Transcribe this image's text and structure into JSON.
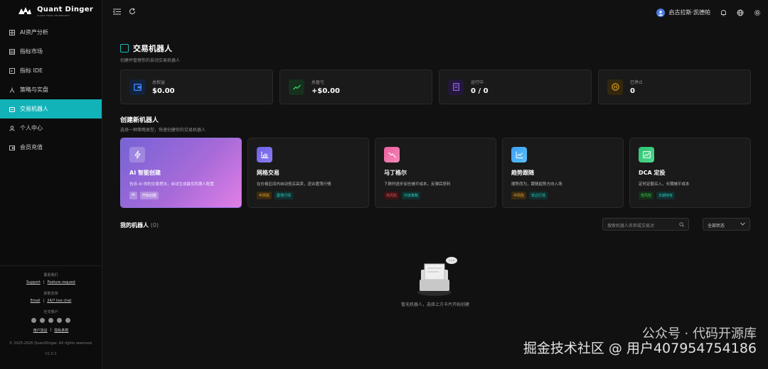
{
  "brand": {
    "title": "Quant Dinger",
    "subtitle": "QUANT FROM UNCERTAINTY"
  },
  "sidebar": {
    "items": [
      {
        "label": "AI资产分析",
        "icon": "chart-grid-icon"
      },
      {
        "label": "指标市场",
        "icon": "store-icon"
      },
      {
        "label": "指标 IDE",
        "icon": "code-icon"
      },
      {
        "label": "策略与实盘",
        "icon": "strategy-icon"
      },
      {
        "label": "交易机器人",
        "icon": "robot-icon",
        "active": true
      },
      {
        "label": "个人中心",
        "icon": "user-icon"
      },
      {
        "label": "会员充值",
        "icon": "wallet-icon"
      }
    ],
    "footer": {
      "contact_head": "联系我们",
      "support": "Support",
      "feature": "Feature request",
      "help_head": "获取支持",
      "email": "Email",
      "live_chat": "24/7 live chat",
      "social_head": "社交账户",
      "terms": "用户协议",
      "privacy": "隐私条款",
      "copyright": "© 2025-2026 QuantDinger. All rights reserved.",
      "version": "V2.0.3"
    }
  },
  "topbar": {
    "user_name": "启古拉斯·凯德帕"
  },
  "page": {
    "title": "交易机器人",
    "subtitle": "创建并管理你的自动交易机器人"
  },
  "stats": [
    {
      "label": "总权益",
      "value": "$0.00",
      "icon": "wallet-icon",
      "color": "#1e6fd9"
    },
    {
      "label": "总盈亏",
      "value": "+$0.00",
      "icon": "trend-up-icon",
      "color": "#2bb24c"
    },
    {
      "label": "运行中",
      "value": "0 / 0",
      "icon": "document-icon",
      "color": "#7a4ad6"
    },
    {
      "label": "已停止",
      "value": "0",
      "icon": "pause-icon",
      "color": "#e0a11d"
    }
  ],
  "create": {
    "title": "创建新机器人",
    "subtitle": "选择一种策略类型，快速创建你的交易机器人"
  },
  "cards": [
    {
      "title": "AI 智能创建",
      "desc": "告诉 AI 你的交易想法，自动生成最优机器人配置",
      "icon": "lightning-icon",
      "tags": [
        "AI",
        "开始创建"
      ]
    },
    {
      "title": "网格交易",
      "desc": "在价格区间内自动低买高卖，适合震荡行情",
      "icon": "bar-chart-icon",
      "tags": [
        "中风险",
        "震荡行情"
      ]
    },
    {
      "title": "马丁格尔",
      "desc": "下跌时逐步加仓摊平成本，反弹后获利",
      "icon": "trend-down-icon",
      "tags": [
        "高风险",
        "抄底策略"
      ]
    },
    {
      "title": "趋势跟随",
      "desc": "顺势而为，跟随趋势方向入场",
      "icon": "trend-line-icon",
      "tags": [
        "中风险",
        "单边行情"
      ]
    },
    {
      "title": "DCA 定投",
      "desc": "定时定额买入，长期摊平成本",
      "icon": "area-chart-icon",
      "tags": [
        "低风险",
        "长期持有"
      ]
    }
  ],
  "robots": {
    "title": "我的机器人",
    "count": "(0)",
    "search_placeholder": "搜索机器人名称或交易对",
    "status_filter": "全部状态",
    "empty_text": "暂无机器人，选择上方卡片开始创建"
  },
  "watermark": {
    "line1": "公众号 · 代码开源库",
    "line2": "掘金技术社区 @ 用户407954754186"
  }
}
